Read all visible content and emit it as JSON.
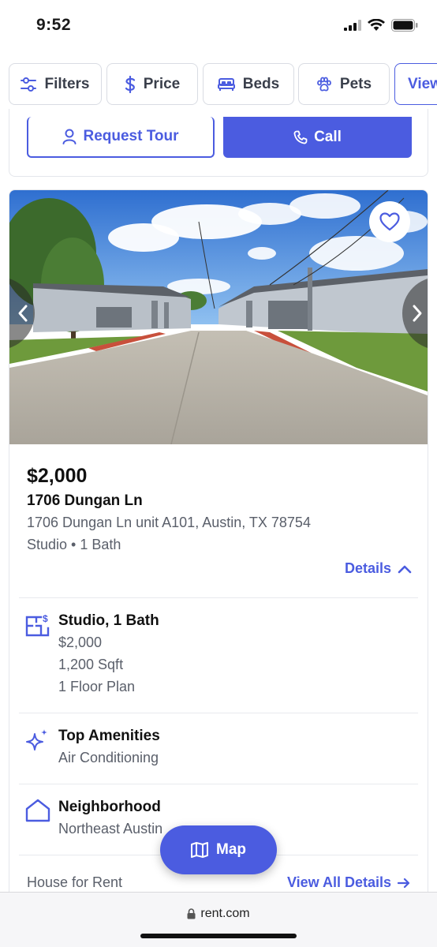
{
  "status": {
    "time": "9:52"
  },
  "filters": [
    {
      "label": "Filters",
      "icon": "sliders-icon"
    },
    {
      "label": "Price",
      "icon": "dollar-icon"
    },
    {
      "label": "Beds",
      "icon": "bed-icon"
    },
    {
      "label": "Pets",
      "icon": "paw-icon"
    },
    {
      "label": "View"
    }
  ],
  "previous_card": {
    "request_tour_label": "Request Tour",
    "call_label": "Call"
  },
  "listing": {
    "price": "$2,000",
    "title": "1706 Dungan Ln",
    "address": "1706 Dungan Ln unit A101, Austin, TX 78754",
    "beds_baths": "Studio • 1 Bath",
    "details_label": "Details",
    "floorplan": {
      "heading": "Studio, 1 Bath",
      "price": "$2,000",
      "sqft": "1,200 Sqft",
      "plans": "1 Floor Plan"
    },
    "amenities": {
      "heading": "Top Amenities",
      "value": "Air Conditioning"
    },
    "neighborhood": {
      "heading": "Neighborhood",
      "value": "Northeast Austin"
    },
    "property_type": "House for Rent",
    "view_all_label": "View All Details"
  },
  "map_button": {
    "label": "Map"
  },
  "browser": {
    "url": "rent.com"
  },
  "colors": {
    "accent": "#4b5ce0",
    "muted_text": "#5a5f6a"
  }
}
